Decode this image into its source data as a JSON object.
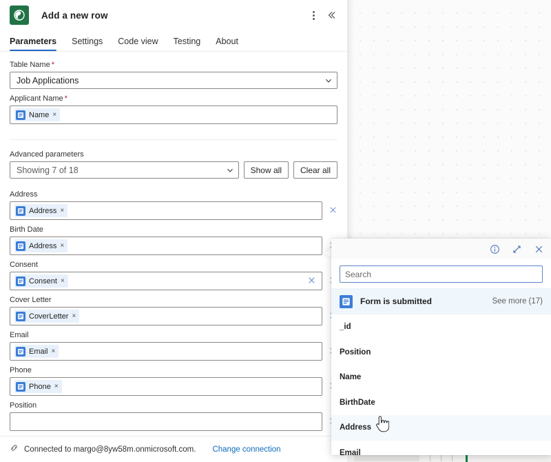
{
  "header": {
    "title": "Add a new row",
    "app_icon": "excel-green-icon",
    "more_icon": "kebab-menu-icon",
    "collapse_icon": "double-chevron-left-icon"
  },
  "tabs": [
    {
      "label": "Parameters",
      "active": true
    },
    {
      "label": "Settings",
      "active": false
    },
    {
      "label": "Code view",
      "active": false
    },
    {
      "label": "Testing",
      "active": false
    },
    {
      "label": "About",
      "active": false
    }
  ],
  "form": {
    "table_name": {
      "label": "Table Name",
      "required": true,
      "value": "Job Applications",
      "chevron": "chevron-down-icon"
    },
    "applicant_name": {
      "label": "Applicant Name",
      "required": true,
      "token": "Name",
      "token_icon": "dynamic-content-icon",
      "token_remove": "×"
    },
    "advanced": {
      "label": "Advanced parameters",
      "value": "Showing 7 of 18",
      "show_all": "Show all",
      "clear_all": "Clear all",
      "chevron": "chevron-down-icon"
    },
    "params": [
      {
        "label": "Address",
        "token": "Address",
        "inner_clear": false
      },
      {
        "label": "Birth Date",
        "token": "Address",
        "inner_clear": false
      },
      {
        "label": "Consent",
        "token": "Consent",
        "inner_clear": true
      },
      {
        "label": "Cover Letter",
        "token": "CoverLetter",
        "inner_clear": false
      },
      {
        "label": "Email",
        "token": "Email",
        "inner_clear": false
      },
      {
        "label": "Phone",
        "token": "Phone",
        "inner_clear": false
      },
      {
        "label": "Position",
        "token": "",
        "inner_clear": false
      }
    ],
    "delete_icon": "close-x-icon"
  },
  "footer": {
    "connection_icon": "link-icon",
    "status": "Connected to margo@8yw58m.onmicrosoft.com.",
    "change_link": "Change connection"
  },
  "flyout": {
    "info_icon": "info-circle-icon",
    "expand_icon": "expand-diagonal-icon",
    "close_icon": "close-x-icon",
    "search_placeholder": "Search",
    "search_value": "",
    "group": {
      "icon": "dynamic-content-icon",
      "label": "Form is submitted",
      "see_more": "See more (17)"
    },
    "items": [
      {
        "label": "_id",
        "hover": false
      },
      {
        "label": "Position",
        "hover": false
      },
      {
        "label": "Name",
        "hover": false
      },
      {
        "label": "BirthDate",
        "hover": false
      },
      {
        "label": "Address",
        "hover": true
      },
      {
        "label": "Email",
        "hover": false
      }
    ]
  },
  "cursor": {
    "icon": "pointing-hand-cursor"
  },
  "colors": {
    "accent_blue": "#2266c8",
    "token_blue": "#3b7dd8",
    "token_bg": "#e8f1fb",
    "brand_green": "#217346",
    "link_blue": "#0f6cbd",
    "required_red": "#a4262c",
    "hover_row": "#f3f9fd",
    "group_row": "#eff6fc"
  }
}
